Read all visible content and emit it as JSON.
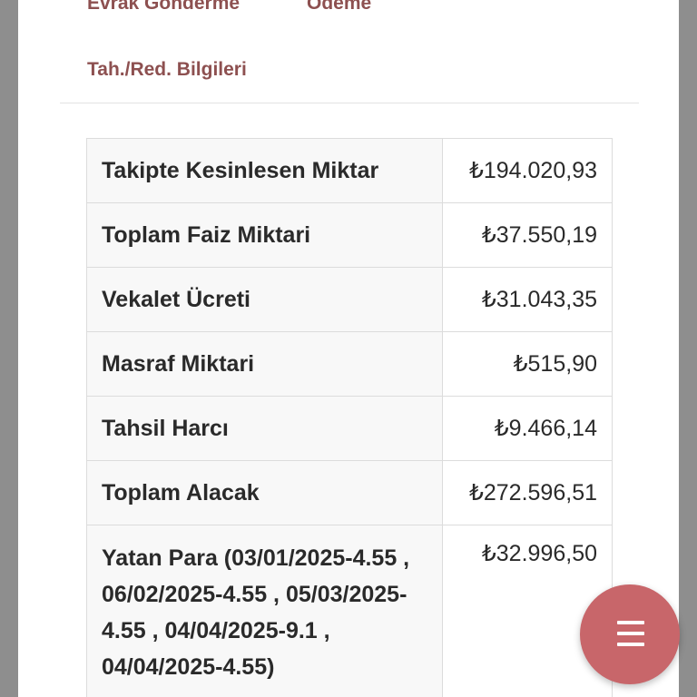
{
  "tabs": {
    "evrak_gonderme": "Evrak Gönderme",
    "odeme": "Ödeme",
    "tah_red": "Tah./Red. Bilgileri"
  },
  "rows": [
    {
      "label": "Takipte Kesinlesen Miktar",
      "value": "₺194.020,93"
    },
    {
      "label": "Toplam Faiz Miktari",
      "value": "₺37.550,19"
    },
    {
      "label": "Vekalet Ücreti",
      "value": "₺31.043,35"
    },
    {
      "label": "Masraf Miktari",
      "value": "₺515,90"
    },
    {
      "label": "Tahsil Harcı",
      "value": "₺9.466,14"
    },
    {
      "label": "Toplam Alacak",
      "value": "₺272.596,51"
    },
    {
      "label": "Yatan Para (03/01/2025-4.55 , 06/02/2025-4.55 , 05/03/2025-4.55 , 04/04/2025-9.1 , 04/04/2025-4.55)",
      "value": "₺32.996,50"
    }
  ],
  "fab": {
    "icon": "menu-icon"
  },
  "colors": {
    "accent": "#8d5050",
    "fab": "#c8666a"
  }
}
